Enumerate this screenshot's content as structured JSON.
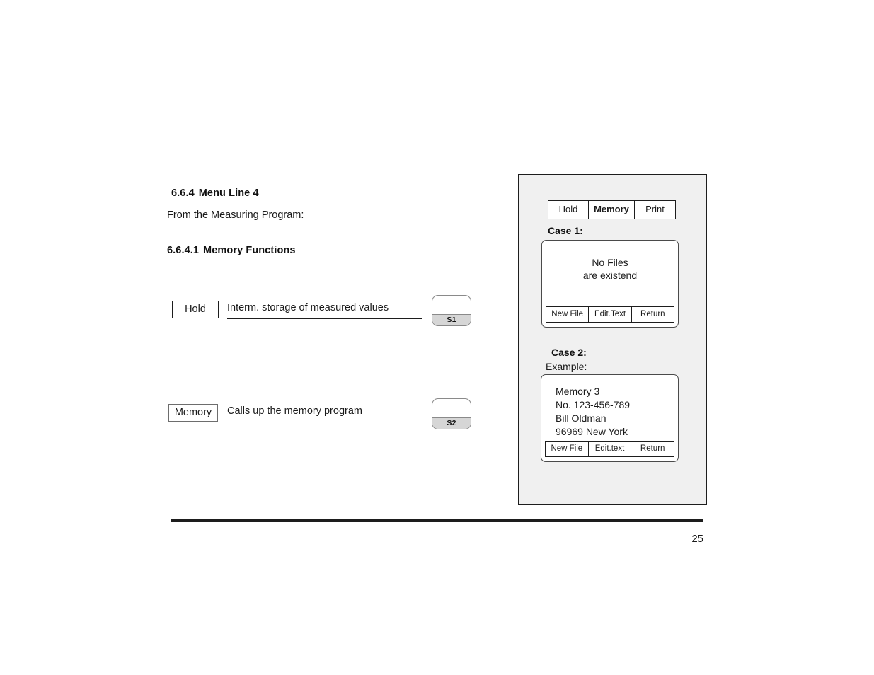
{
  "document": {
    "page_number": "25"
  },
  "left": {
    "section_number": "6.6.4",
    "section_title": "Menu Line 4",
    "intro_text": "From the Measuring Program:",
    "subsection_number": "6.6.4.1",
    "subsection_title": "Memory Functions",
    "rows": [
      {
        "key_label": "Hold",
        "description": "Interm. storage of measured values",
        "softkey": "S1"
      },
      {
        "key_label": "Memory",
        "description": "Calls up the memory program",
        "softkey": "S2"
      }
    ]
  },
  "panel": {
    "menubar": {
      "items": [
        {
          "label": "Hold",
          "selected": false
        },
        {
          "label": "Memory",
          "selected": true
        },
        {
          "label": "Print",
          "selected": false
        }
      ]
    },
    "case1": {
      "label": "Case 1:",
      "screen_lines": [
        "No Files",
        "are existend"
      ],
      "softkeys": [
        "New File",
        "Edit.Text",
        "Return"
      ]
    },
    "case2": {
      "label": "Case 2:",
      "example_label": "Example:",
      "screen_lines": [
        "Memory 3",
        "No. 123-456-789",
        "Bill Oldman",
        "96969 New York"
      ],
      "softkeys": [
        "New File",
        "Edit.text",
        "Return"
      ]
    }
  },
  "colors": {
    "panel_background": "#f0f0f0",
    "panel_border": "#1d1d1d",
    "screen_background": "#ffffff",
    "softkey_cap": "#d6d6d6",
    "text": "#1a1a1a"
  }
}
